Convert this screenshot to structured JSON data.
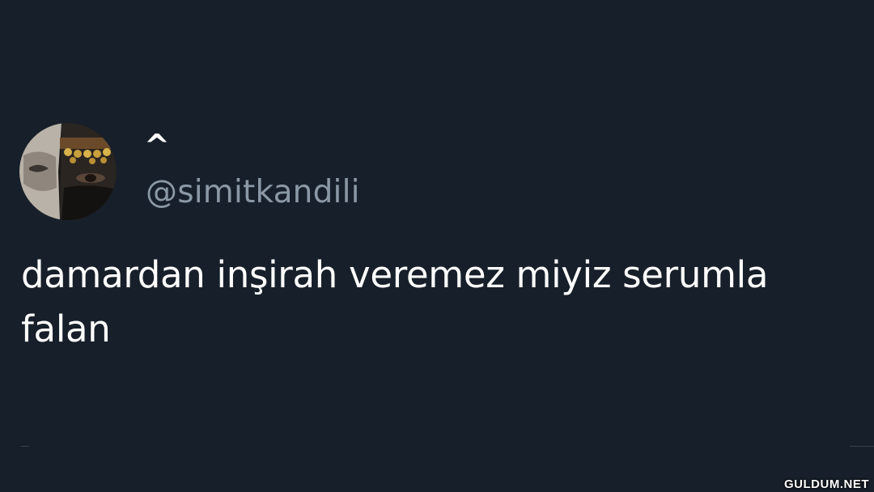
{
  "tweet": {
    "display_name": "^",
    "handle": "@simitkandili",
    "text": "damardan inşirah veremez miyiz serumla falan"
  },
  "avatar": {
    "icon": "profile-photo"
  },
  "watermark": {
    "text": "GULDUM.NET"
  },
  "colors": {
    "background": "#17202a",
    "primary_text": "#ffffff",
    "secondary_text": "#8b98a5"
  }
}
